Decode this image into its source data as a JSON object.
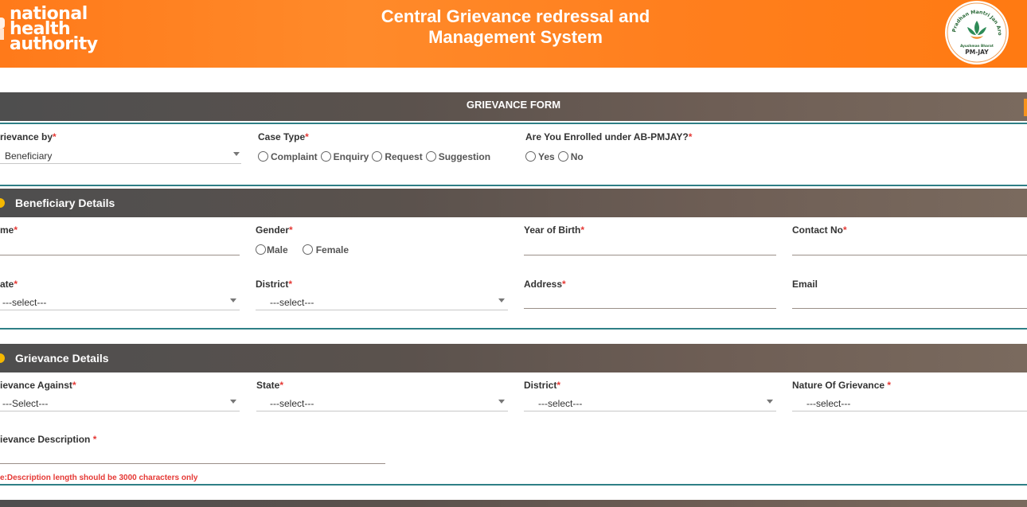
{
  "header": {
    "logo_left_lines": [
      "national",
      "health",
      "authority"
    ],
    "title_line1": "Central Grievance redressal and",
    "title_line2": "Management System",
    "logo_right_arc": "Pradhan Mantri Jan Arogya Yojana",
    "logo_right_sub": "Ayushman Bharat",
    "logo_right_badge": "PM-JAY",
    "colors": {
      "header_orange": "#ff7f1e",
      "section_bar": "#5b524d",
      "divider_teal": "#2e7f86",
      "required_red": "#e53935"
    }
  },
  "form": {
    "title": "GRIEVANCE FORM",
    "grievance_by": {
      "label": "rievance by",
      "value": "Beneficiary"
    },
    "case_type": {
      "label": "Case Type",
      "options": [
        "Complaint",
        "Enquiry",
        "Request",
        "Suggestion"
      ]
    },
    "enrolled": {
      "label": "Are You Enrolled under AB-PMJAY?",
      "options": [
        "Yes",
        "No"
      ]
    }
  },
  "beneficiary": {
    "title": "Beneficiary Details",
    "name_label": "me",
    "gender_label": "Gender",
    "gender_options": [
      "Male",
      "Female"
    ],
    "yob_label": "Year of Birth",
    "contact_label": "Contact No",
    "state_label": "ate",
    "state_value": "---select---",
    "district_label": "District",
    "district_value": "---select---",
    "address_label": "Address",
    "email_label": "Email"
  },
  "grievance": {
    "title": "Grievance Details",
    "against_label": "ievance Against",
    "against_value": "---Select---",
    "state_label": "State",
    "state_value": "---select---",
    "district_label": "District",
    "district_value": "---select---",
    "nature_label": "Nature Of Grievance ",
    "nature_value": "---select---",
    "description_label": "ievance Description ",
    "note": "e:Description length should be 3000 characters only"
  },
  "required_mark": "*"
}
